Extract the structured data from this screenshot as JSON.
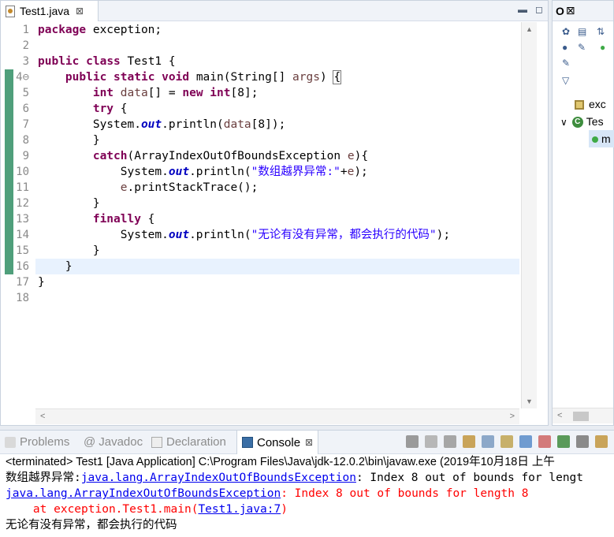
{
  "editor": {
    "tab_title": "Test1.java",
    "tab_close": "⊠",
    "lines": [
      {
        "n": "1",
        "parts": [
          {
            "c": "kw",
            "t": "package"
          },
          {
            "c": "",
            "t": " exception;"
          }
        ]
      },
      {
        "n": "2",
        "parts": []
      },
      {
        "n": "3",
        "parts": [
          {
            "c": "kw",
            "t": "public"
          },
          {
            "c": "",
            "t": " "
          },
          {
            "c": "kw",
            "t": "class"
          },
          {
            "c": "",
            "t": " Test1 {"
          }
        ]
      },
      {
        "n": "4⊖",
        "parts": [
          {
            "c": "",
            "t": "    "
          },
          {
            "c": "kw",
            "t": "public"
          },
          {
            "c": "",
            "t": " "
          },
          {
            "c": "kw",
            "t": "static"
          },
          {
            "c": "",
            "t": " "
          },
          {
            "c": "kw",
            "t": "void"
          },
          {
            "c": "",
            "t": " main(String[] "
          },
          {
            "c": "var",
            "t": "args"
          },
          {
            "c": "",
            "t": ") "
          },
          {
            "c": "brace",
            "t": "{"
          }
        ]
      },
      {
        "n": "5",
        "parts": [
          {
            "c": "",
            "t": "        "
          },
          {
            "c": "kw",
            "t": "int"
          },
          {
            "c": "",
            "t": " "
          },
          {
            "c": "var",
            "t": "data"
          },
          {
            "c": "",
            "t": "[] = "
          },
          {
            "c": "kw",
            "t": "new"
          },
          {
            "c": "",
            "t": " "
          },
          {
            "c": "kw",
            "t": "int"
          },
          {
            "c": "",
            "t": "[8];"
          }
        ]
      },
      {
        "n": "6",
        "parts": [
          {
            "c": "",
            "t": "        "
          },
          {
            "c": "kw",
            "t": "try"
          },
          {
            "c": "",
            "t": " {"
          }
        ]
      },
      {
        "n": "7",
        "parts": [
          {
            "c": "",
            "t": "        System."
          },
          {
            "c": "fld",
            "t": "out"
          },
          {
            "c": "",
            "t": ".println("
          },
          {
            "c": "var",
            "t": "data"
          },
          {
            "c": "",
            "t": "[8]);"
          }
        ]
      },
      {
        "n": "8",
        "parts": [
          {
            "c": "",
            "t": "        }"
          }
        ]
      },
      {
        "n": "9",
        "parts": [
          {
            "c": "",
            "t": "        "
          },
          {
            "c": "kw",
            "t": "catch"
          },
          {
            "c": "",
            "t": "(ArrayIndexOutOfBoundsException "
          },
          {
            "c": "var",
            "t": "e"
          },
          {
            "c": "",
            "t": "){"
          }
        ]
      },
      {
        "n": "10",
        "parts": [
          {
            "c": "",
            "t": "            System."
          },
          {
            "c": "fld",
            "t": "out"
          },
          {
            "c": "",
            "t": ".println("
          },
          {
            "c": "str",
            "t": "\"数组越界异常:\""
          },
          {
            "c": "",
            "t": "+"
          },
          {
            "c": "var",
            "t": "e"
          },
          {
            "c": "",
            "t": ");"
          }
        ]
      },
      {
        "n": "11",
        "parts": [
          {
            "c": "",
            "t": "            "
          },
          {
            "c": "var",
            "t": "e"
          },
          {
            "c": "",
            "t": ".printStackTrace();"
          }
        ]
      },
      {
        "n": "12",
        "parts": [
          {
            "c": "",
            "t": "        }"
          }
        ]
      },
      {
        "n": "13",
        "parts": [
          {
            "c": "",
            "t": "        "
          },
          {
            "c": "kw",
            "t": "finally"
          },
          {
            "c": "",
            "t": " {"
          }
        ]
      },
      {
        "n": "14",
        "parts": [
          {
            "c": "",
            "t": "            System."
          },
          {
            "c": "fld",
            "t": "out"
          },
          {
            "c": "",
            "t": ".println("
          },
          {
            "c": "str",
            "t": "\"无论有没有异常，都会执行的代码\""
          },
          {
            "c": "",
            "t": ");"
          }
        ]
      },
      {
        "n": "15",
        "parts": [
          {
            "c": "",
            "t": "        }"
          }
        ]
      },
      {
        "n": "16",
        "parts": [
          {
            "c": "",
            "t": "    }"
          }
        ]
      },
      {
        "n": "17",
        "parts": [
          {
            "c": "",
            "t": "}"
          }
        ]
      },
      {
        "n": "18",
        "parts": []
      }
    ]
  },
  "outline": {
    "tab_label": "O",
    "tab_icon_text": "⊠",
    "items": [
      {
        "label": "exc",
        "icon": "package-icon"
      },
      {
        "label": "Tes",
        "icon": "class-icon",
        "expander": "∨"
      },
      {
        "label": "m",
        "icon": "method-icon"
      }
    ]
  },
  "console": {
    "tabs": [
      {
        "label": "Problems",
        "icon": "problems-icon"
      },
      {
        "label": "Javadoc",
        "icon": "javadoc-icon"
      },
      {
        "label": "Declaration",
        "icon": "declaration-icon"
      },
      {
        "label": "Console",
        "icon": "console-icon",
        "active": true
      }
    ],
    "tab_close": "⊠",
    "header": "<terminated> Test1 [Java Application] C:\\Program Files\\Java\\jdk-12.0.2\\bin\\javaw.exe (2019年10月18日 上午",
    "out1_prefix": "数组越界异常:",
    "out1_link": "java.lang.ArrayIndexOutOfBoundsException",
    "out1_suffix": ": Index 8 out of bounds for lengt",
    "err1_link": "java.lang.ArrayIndexOutOfBoundsException",
    "err1_suffix": ": Index 8 out of bounds for length 8",
    "err2_prefix": "    at exception.Test1.main(",
    "err2_link": "Test1.java:7",
    "err2_suffix": ")",
    "out2": "无论有没有异常，都会执行的代码"
  },
  "colors": {
    "keyword": "#7f0055",
    "string": "#2a00ff",
    "field": "#0000c0",
    "error": "#ff0000",
    "gutter_change": "#4f9f7b"
  }
}
